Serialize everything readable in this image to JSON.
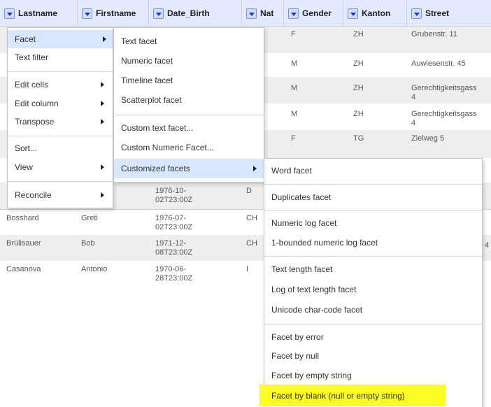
{
  "columns": [
    "Lastname",
    "Firstname",
    "Date_Birth",
    "Nat",
    "Gender",
    "Kanton",
    "Street"
  ],
  "rows": [
    {
      "Gender": "F",
      "Kanton": "ZH",
      "Street": "Grubenstr. 11"
    },
    {
      "Gender": "M",
      "Kanton": "ZH",
      "Street": "Auwiesenstr. 45"
    },
    {
      "Gender": "M",
      "Kanton": "ZH",
      "Street": "Gerechtigkeitsgass\n4"
    },
    {
      "Gender": "M",
      "Kanton": "ZH",
      "Street": "Gerechtigkeitsgass\n4"
    },
    {
      "Gender": "F",
      "Kanton": "TG",
      "Street": "Zielweg 5"
    },
    {
      "Lastname": "",
      "Firstname": "",
      "Date_Birth": "",
      "Nat": ""
    },
    {
      "Firstname": "e",
      "Date_Birth": "1976-10-\n02T23:00Z",
      "Nat": "D"
    },
    {
      "Lastname": "Bosshard",
      "Firstname": "Greti",
      "Date_Birth": "1976-07-\n02T23:00Z",
      "Nat": "CH"
    },
    {
      "Lastname": "Brülisauer",
      "Firstname": "Bob",
      "Date_Birth": "1971-12-\n08T23:00Z",
      "Nat": "CH",
      "Street": "4"
    },
    {
      "Lastname": "Casanova",
      "Firstname": "Antonio",
      "Date_Birth": "1970-06-\n28T23:00Z",
      "Nat": "I"
    }
  ],
  "menu_main": {
    "items": [
      "Facet",
      "Text filter",
      "Edit cells",
      "Edit column",
      "Transpose",
      "Sort...",
      "View",
      "Reconcile"
    ]
  },
  "menu_facet": {
    "items": [
      "Text facet",
      "Numeric facet",
      "Timeline facet",
      "Scatterplot facet",
      "Custom text facet...",
      "Custom Numeric Facet...",
      "Customized facets"
    ]
  },
  "menu_custom": {
    "items": [
      "Word facet",
      "Duplicates facet",
      "Numeric log facet",
      "1-bounded numeric log facet",
      "Text length facet",
      "Log of text length facet",
      "Unicode char-code facet",
      "Facet by error",
      "Facet by null",
      "Facet by empty string",
      "Facet by blank (null or empty string)"
    ]
  },
  "colors": {
    "header_bg": "#e3e9ff",
    "selected_bg": "#d8e6ff",
    "highlight": "#fbfd25"
  }
}
